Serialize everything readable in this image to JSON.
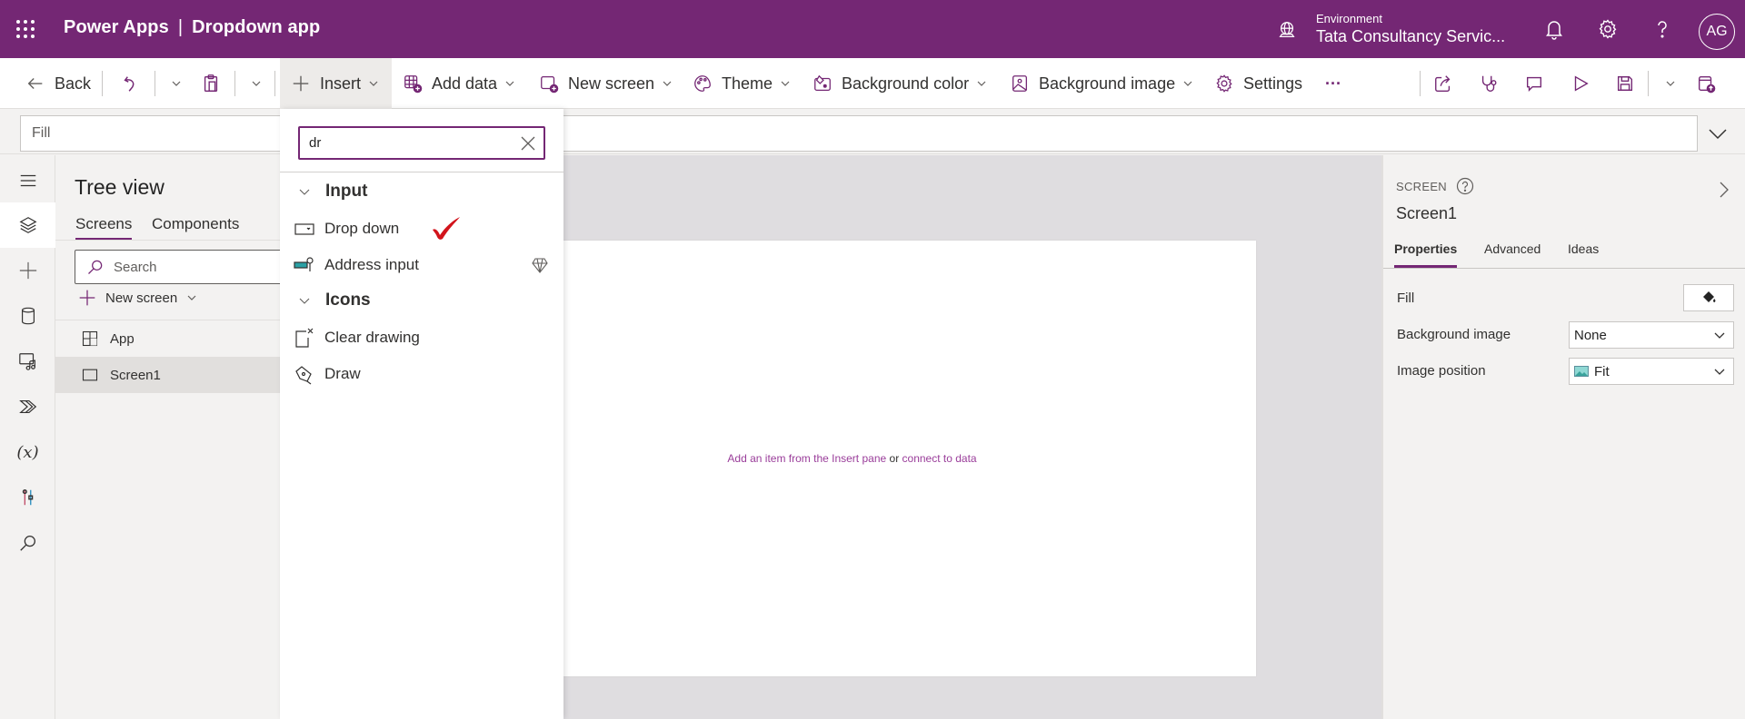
{
  "header": {
    "product": "Power Apps",
    "separator": "|",
    "app_name": "Dropdown app",
    "environment_label": "Environment",
    "environment_name": "Tata Consultancy Servic...",
    "avatar_initials": "AG",
    "brand_color": "#742774"
  },
  "toolbar": {
    "back": "Back",
    "insert": "Insert",
    "add_data": "Add data",
    "new_screen": "New screen",
    "theme": "Theme",
    "background_color": "Background color",
    "background_image": "Background image",
    "settings": "Settings",
    "more": "···"
  },
  "formula_bar": {
    "property": "Fill",
    "formula": ""
  },
  "tree_view": {
    "title": "Tree view",
    "tabs": [
      {
        "label": "Screens",
        "active": true
      },
      {
        "label": "Components",
        "active": false
      }
    ],
    "search_placeholder": "Search",
    "new_screen": "New screen",
    "nodes": [
      {
        "label": "App",
        "selected": false
      },
      {
        "label": "Screen1",
        "selected": true
      }
    ]
  },
  "insert_panel": {
    "search_value": "dr",
    "groups": [
      {
        "label": "Input",
        "items": [
          {
            "label": "Drop down",
            "annotated_checkmark": true
          },
          {
            "label": "Address input",
            "premium": true
          }
        ]
      },
      {
        "label": "Icons",
        "items": [
          {
            "label": "Clear drawing"
          },
          {
            "label": "Draw"
          }
        ]
      }
    ]
  },
  "canvas": {
    "hint_part1": "Add an item from the Insert pane",
    "hint_or": "or",
    "hint_link": "connect to data"
  },
  "properties_panel": {
    "kind": "SCREEN",
    "name": "Screen1",
    "tabs": [
      {
        "label": "Properties",
        "active": true
      },
      {
        "label": "Advanced",
        "active": false
      },
      {
        "label": "Ideas",
        "active": false
      }
    ],
    "fill_label": "Fill",
    "background_image_label": "Background image",
    "background_image_value": "None",
    "image_position_label": "Image position",
    "image_position_value": "Fit"
  }
}
